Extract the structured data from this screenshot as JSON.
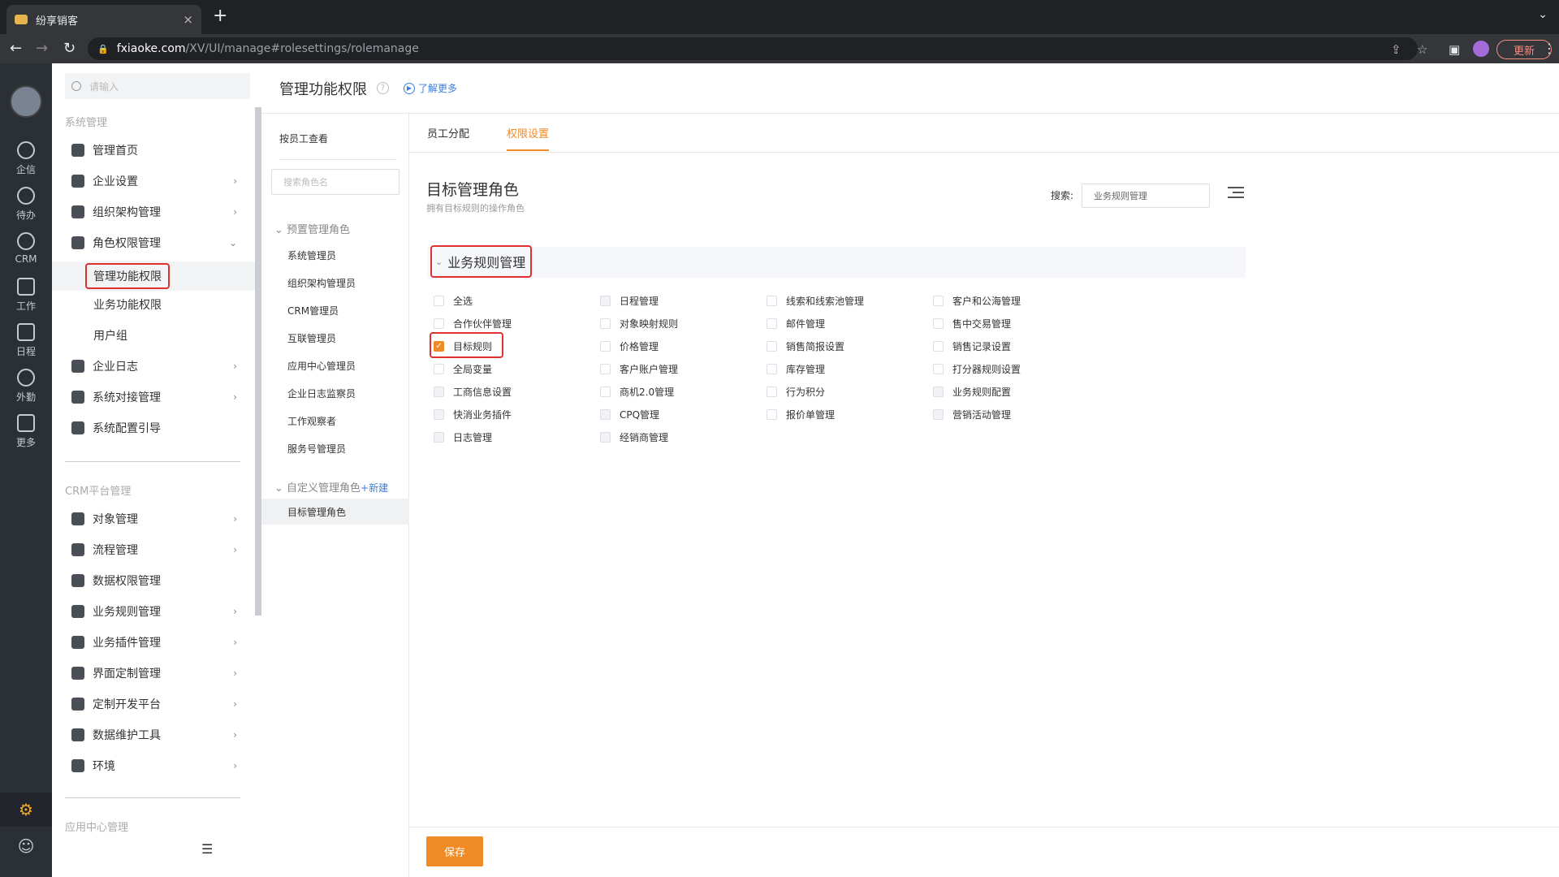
{
  "browser": {
    "tab_title": "纷享销客",
    "url_host": "fxiaoke.com",
    "url_path": "/XV/UI/manage#rolesettings/rolemanage",
    "update_label": "更新"
  },
  "rail": {
    "items": [
      {
        "label": "企信",
        "icon": "chat-icon"
      },
      {
        "label": "待办",
        "icon": "check-circle-icon"
      },
      {
        "label": "CRM",
        "icon": "clock-icon"
      },
      {
        "label": "工作",
        "icon": "briefcase-icon"
      },
      {
        "label": "日程",
        "icon": "calendar-icon"
      },
      {
        "label": "外勤",
        "icon": "location-icon"
      },
      {
        "label": "更多",
        "icon": "grid-icon"
      }
    ]
  },
  "menu": {
    "search_placeholder": "请输入",
    "group1_title": "系统管理",
    "items1": [
      {
        "label": "管理首页"
      },
      {
        "label": "企业设置"
      },
      {
        "label": "组织架构管理"
      },
      {
        "label": "角色权限管理"
      }
    ],
    "subitems": [
      {
        "label": "管理功能权限"
      },
      {
        "label": "业务功能权限"
      },
      {
        "label": "用户组"
      }
    ],
    "items2": [
      {
        "label": "企业日志"
      },
      {
        "label": "系统对接管理"
      },
      {
        "label": "系统配置引导"
      }
    ],
    "group2_title": "CRM平台管理",
    "items3": [
      {
        "label": "对象管理"
      },
      {
        "label": "流程管理"
      },
      {
        "label": "数据权限管理"
      },
      {
        "label": "业务规则管理"
      },
      {
        "label": "业务插件管理"
      },
      {
        "label": "界面定制管理"
      },
      {
        "label": "定制开发平台"
      },
      {
        "label": "数据维护工具"
      },
      {
        "label": "环境"
      }
    ],
    "group3_title": "应用中心管理"
  },
  "header": {
    "title": "管理功能权限",
    "learn_more": "了解更多"
  },
  "roles": {
    "by_employee": "按员工查看",
    "search_placeholder": "搜索角色名",
    "preset_group": "预置管理角色",
    "preset": [
      {
        "label": "系统管理员"
      },
      {
        "label": "组织架构管理员"
      },
      {
        "label": "CRM管理员"
      },
      {
        "label": "互联管理员"
      },
      {
        "label": "应用中心管理员"
      },
      {
        "label": "企业日志监察员"
      },
      {
        "label": "工作观察者"
      },
      {
        "label": "服务号管理员"
      }
    ],
    "custom_group": "自定义管理角色",
    "new_label": "+新建",
    "custom": [
      {
        "label": "目标管理角色"
      }
    ]
  },
  "main": {
    "tabs": [
      {
        "label": "员工分配"
      },
      {
        "label": "权限设置"
      }
    ],
    "role_title": "目标管理角色",
    "role_desc": "拥有目标规则的操作角色",
    "search_label": "搜索:",
    "search_value": "业务规则管理",
    "section_title": "业务规则管理",
    "columns": [
      [
        {
          "label": "全选",
          "checked": false,
          "disabled": false
        },
        {
          "label": "合作伙伴管理",
          "checked": false,
          "disabled": false
        },
        {
          "label": "目标规则",
          "checked": true,
          "disabled": false
        },
        {
          "label": "全局变量",
          "checked": false,
          "disabled": false
        },
        {
          "label": "工商信息设置",
          "checked": false,
          "disabled": true
        },
        {
          "label": "快消业务插件",
          "checked": false,
          "disabled": true
        },
        {
          "label": "日志管理",
          "checked": false,
          "disabled": true
        }
      ],
      [
        {
          "label": "日程管理",
          "checked": false,
          "disabled": true
        },
        {
          "label": "对象映射规则",
          "checked": false,
          "disabled": false
        },
        {
          "label": "价格管理",
          "checked": false,
          "disabled": false
        },
        {
          "label": "客户账户管理",
          "checked": false,
          "disabled": false
        },
        {
          "label": "商机2.0管理",
          "checked": false,
          "disabled": false
        },
        {
          "label": "CPQ管理",
          "checked": false,
          "disabled": true
        },
        {
          "label": "经销商管理",
          "checked": false,
          "disabled": true
        }
      ],
      [
        {
          "label": "线索和线索池管理",
          "checked": false,
          "disabled": false
        },
        {
          "label": "邮件管理",
          "checked": false,
          "disabled": false
        },
        {
          "label": "销售简报设置",
          "checked": false,
          "disabled": false
        },
        {
          "label": "库存管理",
          "checked": false,
          "disabled": false
        },
        {
          "label": "行为积分",
          "checked": false,
          "disabled": false
        },
        {
          "label": "报价单管理",
          "checked": false,
          "disabled": false
        }
      ],
      [
        {
          "label": "客户和公海管理",
          "checked": false,
          "disabled": false
        },
        {
          "label": "售中交易管理",
          "checked": false,
          "disabled": false
        },
        {
          "label": "销售记录设置",
          "checked": false,
          "disabled": false
        },
        {
          "label": "打分器规则设置",
          "checked": false,
          "disabled": false
        },
        {
          "label": "业务规则配置",
          "checked": false,
          "disabled": true
        },
        {
          "label": "营销活动管理",
          "checked": false,
          "disabled": true
        }
      ]
    ],
    "save_label": "保存"
  },
  "colors": {
    "accent": "#f08a24",
    "highlight": "#e03131",
    "rail_bg": "#2b2f36"
  }
}
